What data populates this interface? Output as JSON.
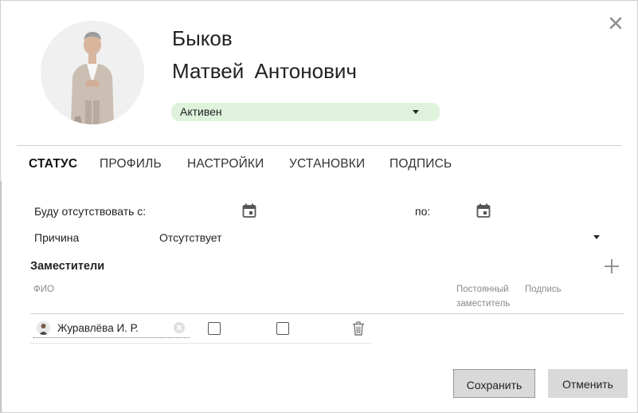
{
  "employee": {
    "last_name": "Быков",
    "first_name": "Матвей  Антонович",
    "status": "Активен",
    "status_color": "#dff3dc"
  },
  "tabs": [
    {
      "label": "СТАТУС",
      "active": true
    },
    {
      "label": "ПРОФИЛЬ",
      "active": false
    },
    {
      "label": "НАСТРОЙКИ",
      "active": false
    },
    {
      "label": "УСТАНОВКИ",
      "active": false
    },
    {
      "label": "ПОДПИСЬ",
      "active": false
    }
  ],
  "absence": {
    "from_label": "Буду отсутствовать с:",
    "to_label": "по:",
    "reason_label": "Причина",
    "reason_value": "Отсутствует"
  },
  "deputies": {
    "title": "Заместители",
    "columns": {
      "fio": "ФИО",
      "permanent_line1": "Постоянный",
      "permanent_line2": "заместитель",
      "signature": "Подпись"
    },
    "rows": [
      {
        "name": "Журавлёва И. Р.",
        "permanent": false,
        "signature": false
      }
    ]
  },
  "buttons": {
    "save": "Сохранить",
    "cancel": "Отменить"
  },
  "icons": {
    "close": "close-icon",
    "calendar": "calendar-icon",
    "add": "plus-icon",
    "delete": "trash-icon",
    "dropdown": "chevron-down-icon",
    "clear": "clear-icon"
  }
}
